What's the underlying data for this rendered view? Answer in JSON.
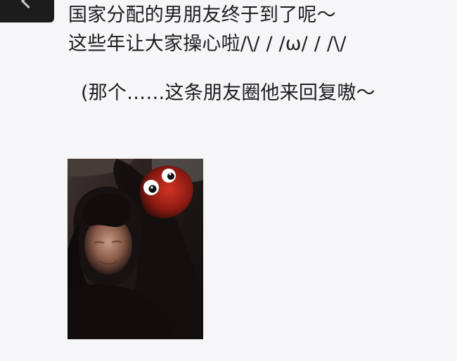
{
  "post": {
    "line1": "国家分配的男朋友终于到了呢～",
    "line2": "这些年让大家操心啦/\\/ / /ω/ / /\\/",
    "line3": "(那个……这条朋友圈他来回复嗷～"
  },
  "colors": {
    "background": "#f6f6f8",
    "text": "#1d1d1f",
    "avatar": "#1c1c1c"
  },
  "icons": {
    "avatar_glyph": "back-chevron-icon"
  }
}
